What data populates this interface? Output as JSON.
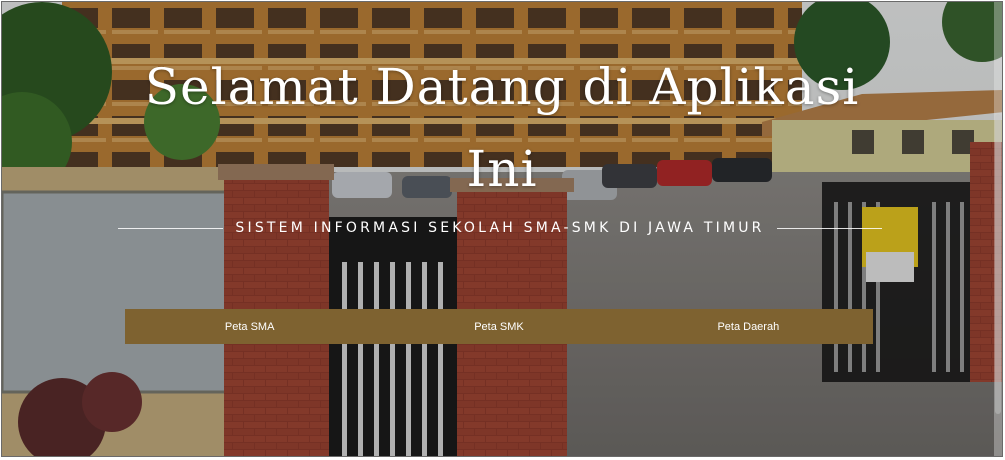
{
  "hero": {
    "title": "Selamat Datang di Aplikasi Ini",
    "subtitle": "SISTEM INFORMASI SEKOLAH SMA-SMK DI JAWA TIMUR"
  },
  "nav": {
    "peta_sma": "Peta SMA",
    "peta_smk": "Peta SMK",
    "peta_daerah": "Peta Daerah"
  },
  "colors": {
    "nav_background": "#7e6230",
    "text": "#ffffff"
  }
}
